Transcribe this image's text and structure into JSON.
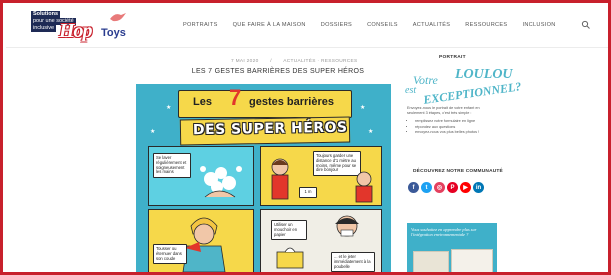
{
  "logo": {
    "line1": "Solutions",
    "line2": "pour une société",
    "line3": "inclusive",
    "hop": "Hop",
    "toys": "Toys"
  },
  "nav": {
    "items": [
      "PORTRAITS",
      "QUE FAIRE À LA MAISON",
      "DOSSIERS",
      "CONSEILS",
      "ACTUALITÉS",
      "RESSOURCES",
      "INCLUSION"
    ]
  },
  "article": {
    "date": "7 MAI 2020",
    "separator": "/",
    "categories": "ACTUALITÉS · RESSOURCES",
    "title": "LES 7 GESTES BARRIÈRES DES SUPER HÉROS"
  },
  "poster": {
    "heading_a": "Les",
    "number": "7",
    "heading_b": "gestes barrières",
    "subheading": "DES SUPER HÉROS",
    "bubble1": "Se laver régulièrement et soigneusement les mains",
    "bubble2": "Toujours garder une distance d'1 mètre au moins, même pour se dire bonjour",
    "bubble3": "Tousser ou éternuer dans son coude",
    "bubble4": "Utiliser un mouchoir en papier",
    "bubble5": "... et le jeter immédiatement à la poubelle",
    "sign": "1 m"
  },
  "sidebar": {
    "heading": "PORTRAIT",
    "lettering1": "Votre",
    "lettering2": "LOULOU",
    "lettering3": "est",
    "lettering4": "EXCEPTIONNEL?",
    "intro": "Envoyez-nous le portrait de votre enfant en seulement 3 étapes, c'est très simple :",
    "steps": [
      "remplissez notre formulaire en ligne",
      "répondez aux questions",
      "envoyez-nous vos plus belles photos !"
    ],
    "steps_bold": "notre formulaire en ligne",
    "community": "DÉCOUVREZ NOTRE COMMUNAUTÉ",
    "socials": [
      {
        "name": "facebook-icon",
        "glyph": "f",
        "color": "#3b5998"
      },
      {
        "name": "twitter-icon",
        "glyph": "t",
        "color": "#1da1f2"
      },
      {
        "name": "instagram-icon",
        "glyph": "◎",
        "color": "#e4405f"
      },
      {
        "name": "pinterest-icon",
        "glyph": "P",
        "color": "#e60023"
      },
      {
        "name": "youtube-icon",
        "glyph": "▶",
        "color": "#ff0000"
      },
      {
        "name": "linkedin-icon",
        "glyph": "in",
        "color": "#0077b5"
      }
    ],
    "promo": "Vous souhaitez en apprendre plus sur l'intégration environnementale ?"
  },
  "colors": {
    "frame": "#c8202c",
    "poster_bg": "#3fb0c9",
    "banner": "#f6d84a",
    "accent_red": "#e2362b"
  }
}
